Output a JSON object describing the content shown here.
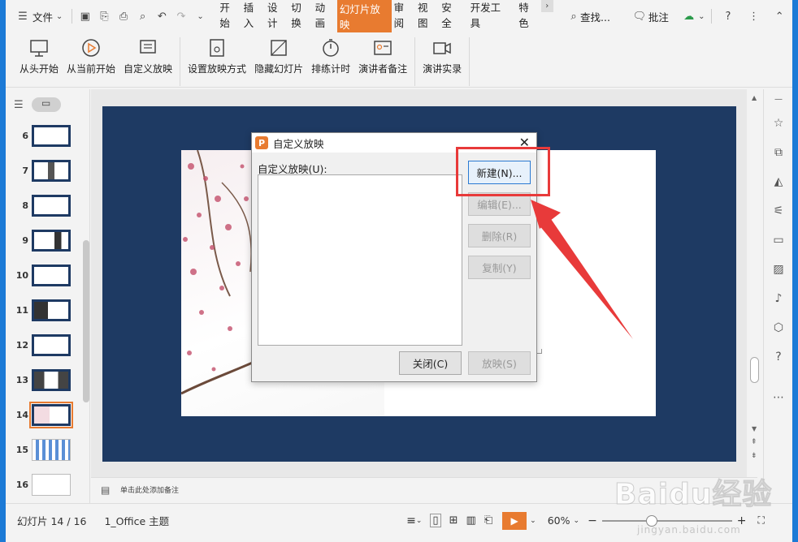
{
  "menubar": {
    "file_label": "文件",
    "tabs": [
      "开始",
      "插入",
      "设计",
      "切换",
      "动画",
      "幻灯片放映",
      "审阅",
      "视图",
      "安全",
      "开发工具",
      "特色"
    ],
    "active_tab": "幻灯片放映",
    "search_label": "查找...",
    "annotate_label": "批注"
  },
  "ribbon": {
    "buttons": [
      "从头开始",
      "从当前开始",
      "自定义放映",
      "设置放映方式",
      "隐藏幻灯片",
      "排练计时",
      "演讲者备注",
      "演讲实录"
    ]
  },
  "slides": {
    "numbers": [
      "6",
      "7",
      "8",
      "9",
      "10",
      "11",
      "12",
      "13",
      "14",
      "15",
      "16"
    ],
    "selected": "14"
  },
  "notes_placeholder": "单击此处添加备注",
  "status": {
    "slide_counter": "幻灯片 14 / 16",
    "theme": "1_Office 主题",
    "zoom": "60%"
  },
  "dialog": {
    "title": "自定义放映",
    "list_label": "自定义放映(U):",
    "new_button": "新建(N)...",
    "edit_button": "编辑(E)...",
    "delete_button": "删除(R)",
    "copy_button": "复制(Y)",
    "close_button": "关闭(C)",
    "show_button": "放映(S)"
  },
  "watermark": {
    "logo": "Baidu经验",
    "url": "jingyan.baidu.com"
  },
  "colors": {
    "accent": "#e87b30",
    "slide_bg": "#1e3a63",
    "annotation": "#e83a3a",
    "window_bg": "#1c7ad6"
  }
}
